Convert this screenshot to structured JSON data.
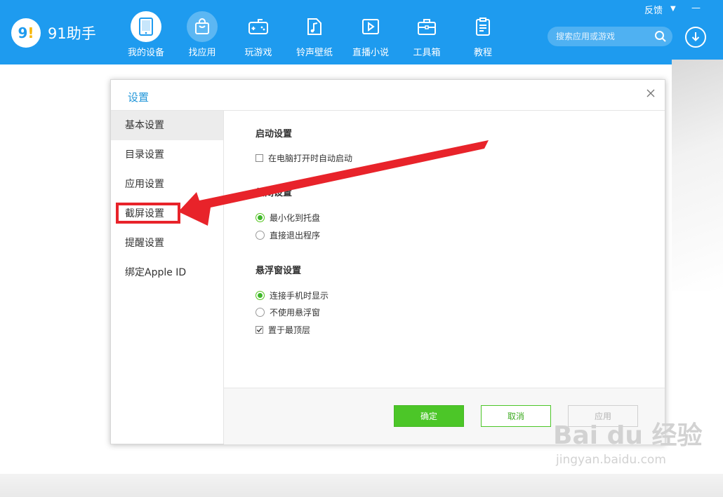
{
  "app": {
    "name": "91助手",
    "logo_text": "9!"
  },
  "window_controls": {
    "feedback": "反馈",
    "menu": "▼",
    "minimize": "—"
  },
  "nav": {
    "items": [
      {
        "label": "我的设备",
        "icon": "tablet-icon",
        "state": "active"
      },
      {
        "label": "找应用",
        "icon": "shopping-bag-icon",
        "state": "hover"
      },
      {
        "label": "玩游戏",
        "icon": "gamepad-icon",
        "state": "normal"
      },
      {
        "label": "铃声壁纸",
        "icon": "music-note-icon",
        "state": "normal"
      },
      {
        "label": "直播小说",
        "icon": "play-icon",
        "state": "normal"
      },
      {
        "label": "工具箱",
        "icon": "toolbox-icon",
        "state": "normal"
      },
      {
        "label": "教程",
        "icon": "clipboard-icon",
        "state": "normal"
      }
    ]
  },
  "search": {
    "placeholder": "搜索应用或游戏",
    "icon": "search-icon"
  },
  "download": {
    "icon": "download-icon"
  },
  "dialog": {
    "title": "设置",
    "close_icon": "close-icon",
    "sidebar": [
      {
        "label": "基本设置",
        "active": true
      },
      {
        "label": "目录设置",
        "active": false
      },
      {
        "label": "应用设置",
        "active": false
      },
      {
        "label": "截屏设置",
        "active": false,
        "highlighted": true
      },
      {
        "label": "提醒设置",
        "active": false
      },
      {
        "label": "绑定Apple ID",
        "active": false
      }
    ],
    "sections": {
      "startup": {
        "title": "启动设置",
        "options": [
          {
            "label": "在电脑打开时自动启动",
            "type": "checkbox",
            "checked": false
          }
        ]
      },
      "close": {
        "title": "关闭设置",
        "options": [
          {
            "label": "最小化到托盘",
            "type": "radio",
            "checked": true
          },
          {
            "label": "直接退出程序",
            "type": "radio",
            "checked": false
          }
        ]
      },
      "float": {
        "title": "悬浮窗设置",
        "options": [
          {
            "label": "连接手机时显示",
            "type": "radio",
            "checked": true
          },
          {
            "label": "不使用悬浮窗",
            "type": "radio",
            "checked": false
          },
          {
            "label": "置于最顶层",
            "type": "checkbox",
            "checked": true
          }
        ]
      }
    },
    "buttons": {
      "ok": "确定",
      "cancel": "取消",
      "apply": "应用"
    }
  },
  "annotation": {
    "color": "#e8232a"
  },
  "watermark": {
    "main": "Bai du 经验",
    "sub": "jingyan.baidu.com"
  },
  "colors": {
    "topbar": "#1e9bef",
    "accent": "#4cc628",
    "title": "#2196d9"
  }
}
